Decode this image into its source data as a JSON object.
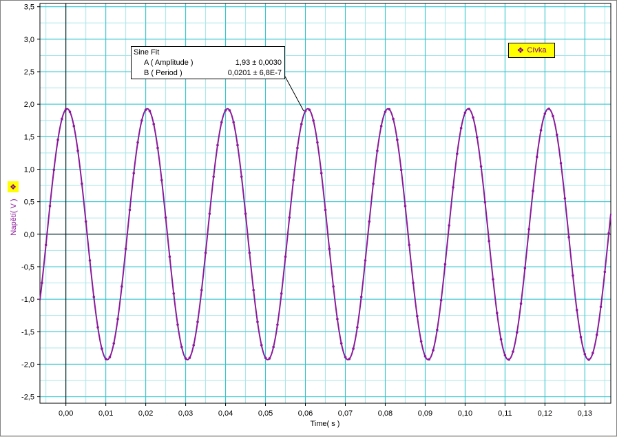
{
  "colors": {
    "grid_major": "#2ec4cc",
    "grid_minor": "#a8e6ea",
    "series": "#8b1a9a",
    "axis": "#000000",
    "legend_bg": "#ffff00"
  },
  "chart_data": {
    "type": "line",
    "xlabel": "Time( s )",
    "ylabel": "Napětí( V )",
    "xlim": [
      -0.0065,
      0.1365
    ],
    "ylim": [
      -2.6,
      3.55
    ],
    "x_ticks": [
      0.0,
      0.01,
      0.02,
      0.03,
      0.04,
      0.05,
      0.06,
      0.07,
      0.08,
      0.09,
      0.1,
      0.11,
      0.12,
      0.13
    ],
    "x_tick_labels": [
      "0,00",
      "0,01",
      "0,02",
      "0,03",
      "0,04",
      "0,05",
      "0,06",
      "0,07",
      "0,08",
      "0,09",
      "0,10",
      "0,11",
      "0,12",
      "0,13"
    ],
    "y_ticks": [
      3.5,
      3.0,
      2.5,
      2.0,
      1.5,
      1.0,
      0.5,
      0.0,
      -0.5,
      -1.0,
      -1.5,
      -2.0,
      -2.5
    ],
    "y_tick_labels": [
      "3,5",
      "3,0",
      "2,5",
      "2,0",
      "1,5",
      "1,0",
      "0,5",
      "0,0",
      "-0,5",
      "-1,0",
      "-1,5",
      "-2,0",
      "-2,5"
    ],
    "grid": true,
    "series": [
      {
        "name": "Cívka",
        "marker": "dot",
        "sample_interval": 0.001,
        "x_start": -0.006,
        "x_end": 0.136,
        "model": "sine",
        "amplitude": 1.93,
        "period": 0.0201,
        "peak_time": 0.0003
      }
    ],
    "fit": {
      "title": "Sine Fit",
      "parameters": [
        {
          "name": "A ( Amplitude )",
          "value": "1,93 ± 0,0030"
        },
        {
          "name": "B ( Period )",
          "value": "0,0201 ± 6,8E-7"
        }
      ]
    },
    "legend": {
      "label": "Cívka",
      "position": "top-right"
    }
  }
}
